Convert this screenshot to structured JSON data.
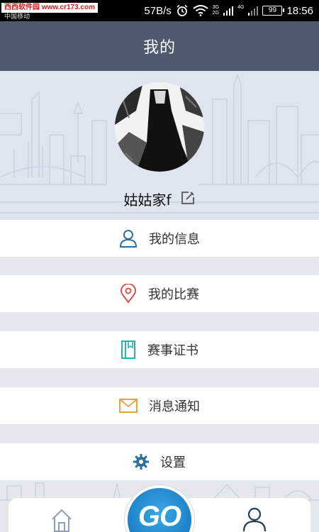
{
  "status_bar": {
    "watermark": "西西软件园 www.cr173.com",
    "carrier": "中国移动",
    "speed": "57B/s",
    "battery": "99",
    "time": "18:56",
    "net_top": "3G",
    "net_bottom": "2G",
    "net_4g": "4G"
  },
  "header": {
    "title": "我的"
  },
  "profile": {
    "nickname": "姑姑家f"
  },
  "menu": [
    {
      "label": "我的信息",
      "icon": "user-icon",
      "color": "#2f6f9e"
    },
    {
      "label": "我的比赛",
      "icon": "location-pin-icon",
      "color": "#d9534f"
    },
    {
      "label": "赛事证书",
      "icon": "certificate-book-icon",
      "color": "#2bb3a6"
    },
    {
      "label": "消息通知",
      "icon": "envelope-icon",
      "color": "#e9a23b"
    },
    {
      "label": "设置",
      "icon": "gear-icon",
      "color": "#2f6f9e"
    }
  ],
  "bottom_nav": {
    "go_label": "GO",
    "home_icon": "home-icon",
    "user_icon": "user-icon"
  },
  "colors": {
    "title_bar": "#4e5b6e",
    "page_bg": "#e4e8ee",
    "go_blue": "#1b7fc6"
  }
}
